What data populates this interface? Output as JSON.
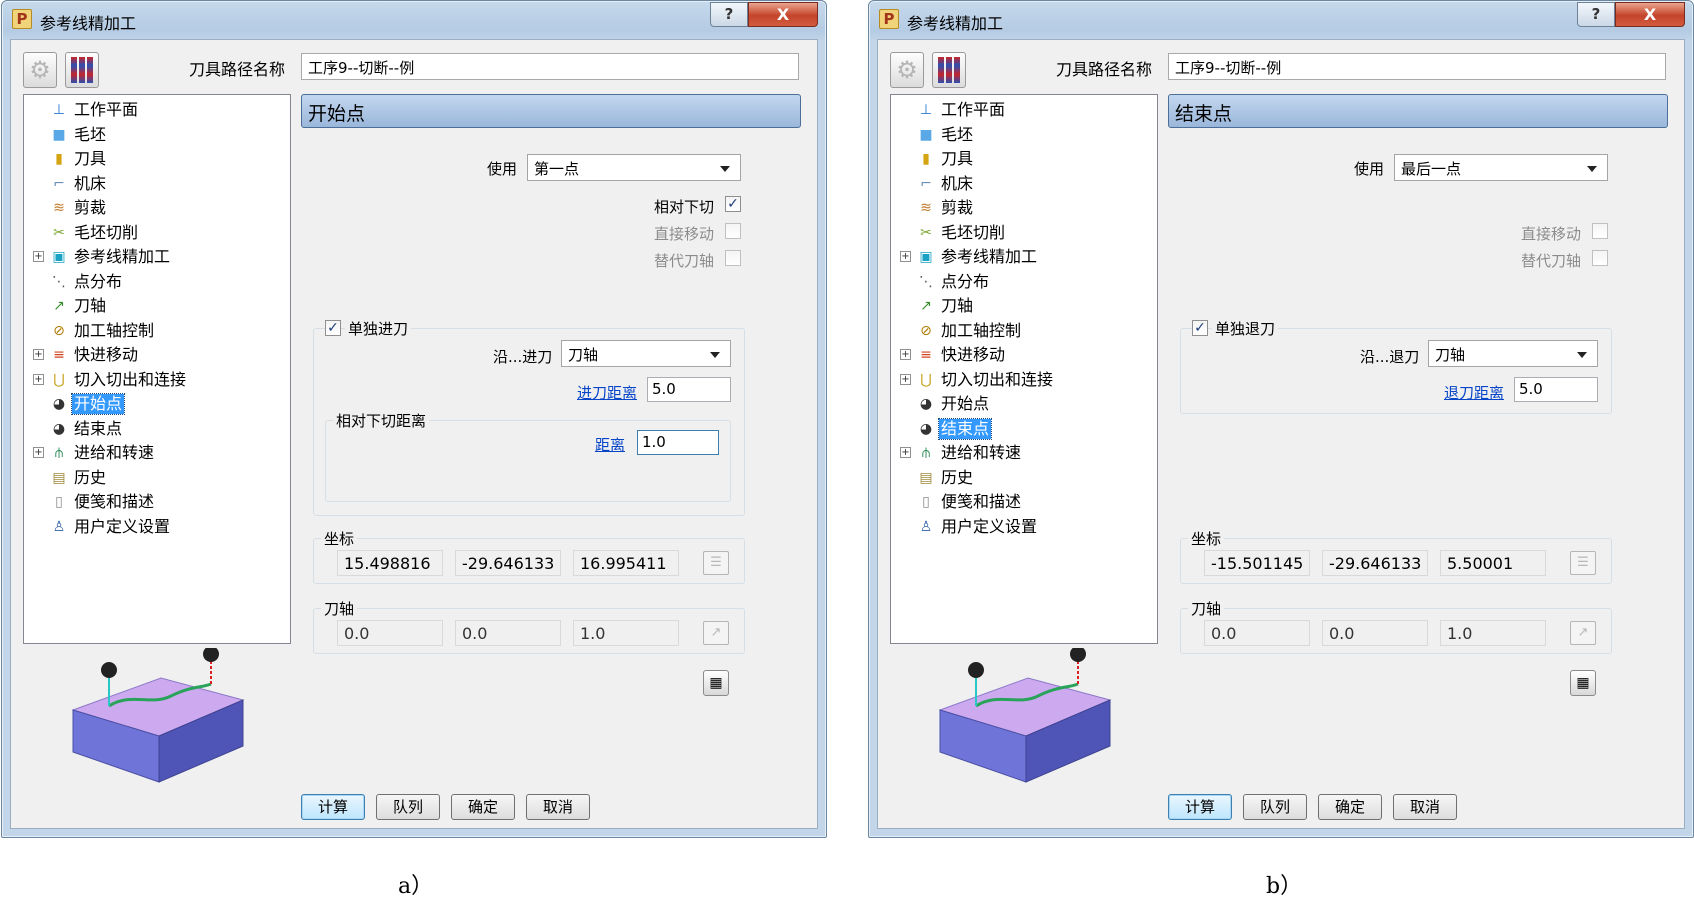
{
  "window_title": "参考线精加工",
  "title_buttons": {
    "help": "?",
    "close": "X"
  },
  "app_icon_letter": "P",
  "toolpath_name_label": "刀具路径名称",
  "toolpath_name": "工序9--切断--例",
  "tree": [
    {
      "label": "工作平面",
      "icon": "workplane-icon",
      "glyph": "⊥",
      "color": "#2a7ad4",
      "expandable": false
    },
    {
      "label": "毛坯",
      "icon": "block-icon",
      "glyph": "■",
      "color": "#5aa9e6",
      "expandable": false
    },
    {
      "label": "刀具",
      "icon": "tool-icon",
      "glyph": "▮",
      "color": "#d4a412",
      "expandable": false
    },
    {
      "label": "机床",
      "icon": "machine-icon",
      "glyph": "⌐",
      "color": "#6a8fb5",
      "expandable": false
    },
    {
      "label": "剪裁",
      "icon": "trim-icon",
      "glyph": "≋",
      "color": "#c27a2a",
      "expandable": false
    },
    {
      "label": "毛坯切削",
      "icon": "stock-cut-icon",
      "glyph": "✂",
      "color": "#7aa12a",
      "expandable": false
    },
    {
      "label": "参考线精加工",
      "icon": "reference-finish-icon",
      "glyph": "▣",
      "color": "#19a2c4",
      "expandable": true
    },
    {
      "label": "点分布",
      "icon": "point-distribution-icon",
      "glyph": "⋱",
      "color": "#555555",
      "expandable": false
    },
    {
      "label": "刀轴",
      "icon": "tool-axis-icon",
      "glyph": "↗",
      "color": "#3a8d2f",
      "expandable": false
    },
    {
      "label": "加工轴控制",
      "icon": "axis-control-icon",
      "glyph": "⊘",
      "color": "#b27a00",
      "expandable": false
    },
    {
      "label": "快进移动",
      "icon": "rapid-move-icon",
      "glyph": "≡",
      "color": "#d2441f",
      "expandable": true
    },
    {
      "label": "切入切出和连接",
      "icon": "leads-links-icon",
      "glyph": "⋃",
      "color": "#c7a21b",
      "expandable": true
    },
    {
      "label": "开始点",
      "icon": "start-point-icon",
      "glyph": "◕",
      "color": "#333333",
      "expandable": false
    },
    {
      "label": "结束点",
      "icon": "end-point-icon",
      "glyph": "◕",
      "color": "#333333",
      "expandable": false
    },
    {
      "label": "进给和转速",
      "icon": "feeds-speeds-icon",
      "glyph": "⫛",
      "color": "#2e8b57",
      "expandable": true
    },
    {
      "label": "历史",
      "icon": "history-icon",
      "glyph": "▤",
      "color": "#a08a3c",
      "expandable": false
    },
    {
      "label": "便笺和描述",
      "icon": "notes-icon",
      "glyph": "▯",
      "color": "#8a8a8a",
      "expandable": false
    },
    {
      "label": "用户定义设置",
      "icon": "user-settings-icon",
      "glyph": "♙",
      "color": "#2f5fa8",
      "expandable": false
    }
  ],
  "panels": [
    {
      "caption": "a）",
      "selected_index": 12,
      "section_title": "开始点",
      "use_label": "使用",
      "use_value": "第一点",
      "checks": [
        {
          "label": "相对下切",
          "checked": true,
          "enabled": true
        },
        {
          "label": "直接移动",
          "checked": false,
          "enabled": false
        },
        {
          "label": "替代刀轴",
          "checked": false,
          "enabled": false
        }
      ],
      "separate_label": "单独进刀",
      "along_label": "沿...进刀",
      "along_value": "刀轴",
      "distance_label": "进刀距离",
      "distance_value": "5.0",
      "relative_group_label": "相对下切距离",
      "relative_distance_label": "距离",
      "relative_distance_value": "1.0",
      "coord_label": "坐标",
      "coords": [
        "15.498816",
        "-29.646133",
        "16.995411"
      ],
      "axis_label": "刀轴",
      "axis": [
        "0.0",
        "0.0",
        "1.0"
      ]
    },
    {
      "caption": "b）",
      "selected_index": 13,
      "section_title": "结束点",
      "use_label": "使用",
      "use_value": "最后一点",
      "checks": [
        {
          "label": "直接移动",
          "checked": false,
          "enabled": false
        },
        {
          "label": "替代刀轴",
          "checked": false,
          "enabled": false
        }
      ],
      "separate_label": "单独退刀",
      "along_label": "沿...退刀",
      "along_value": "刀轴",
      "distance_label": "退刀距离",
      "distance_value": "5.0",
      "coord_label": "坐标",
      "coords": [
        "-15.501145",
        "-29.646133",
        "5.50001"
      ],
      "axis_label": "刀轴",
      "axis": [
        "0.0",
        "0.0",
        "1.0"
      ]
    }
  ],
  "buttons": {
    "calculate": "计算",
    "queue": "队列",
    "ok": "确定",
    "cancel": "取消"
  },
  "colors": {
    "block_top": "#cda9f0",
    "block_front": "#6f75d8",
    "block_side": "#4f55b6",
    "path": "#2aa35a",
    "accent": "#3399ff"
  }
}
